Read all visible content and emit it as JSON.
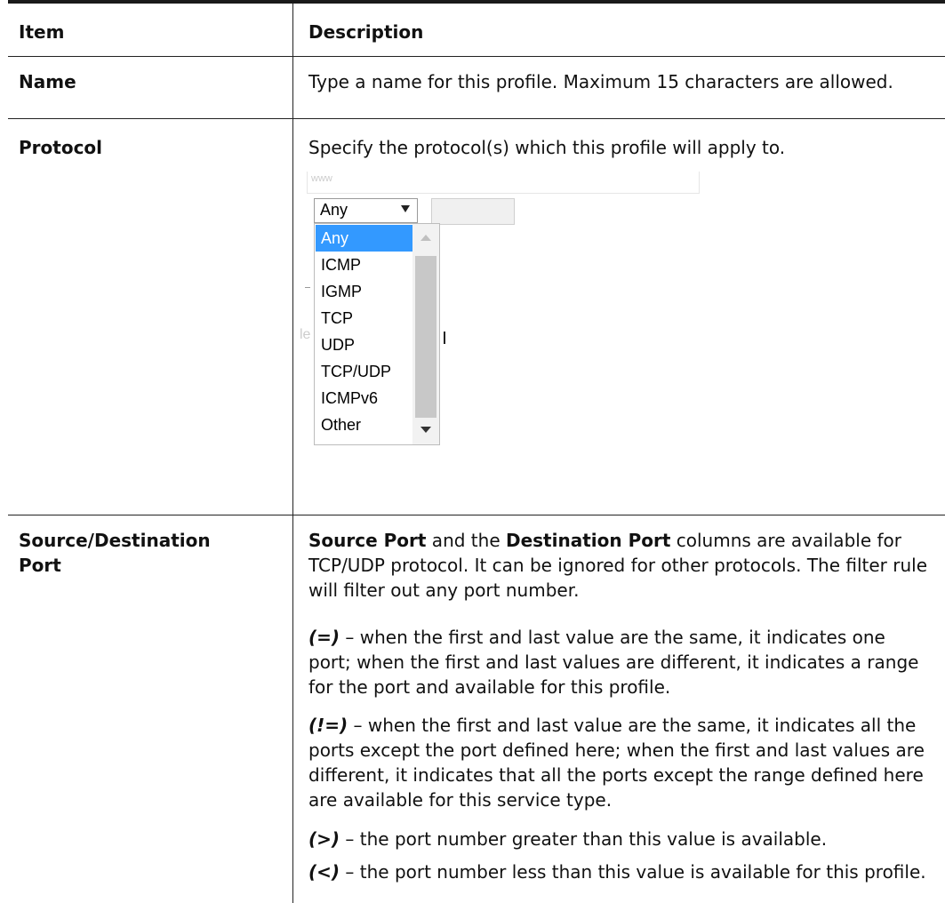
{
  "table": {
    "header": {
      "item": "Item",
      "description": "Description"
    },
    "rows": [
      {
        "item": "Name",
        "description": "Type a name for this profile. Maximum 15 characters are allowed."
      },
      {
        "item": "Protocol",
        "description": "Specify the protocol(s) which this profile will apply to.",
        "screenshot": {
          "faded_field_text": "www",
          "select_value": "Any",
          "options": [
            "Any",
            "ICMP",
            "IGMP",
            "TCP",
            "UDP",
            "TCP/UDP",
            "ICMPv6",
            "Other"
          ],
          "selected_index": 0,
          "background_fragment": "le"
        }
      },
      {
        "item_line1": "Source/Destination",
        "item_line2": "Port",
        "intro": {
          "bold1": "Source Port",
          "text1": " and the ",
          "bold2": "Destination Port",
          "text2": " columns are available for TCP/UDP protocol. It can be ignored for other protocols. The filter rule will filter out any port number."
        },
        "items": [
          {
            "symbol": "(=)",
            "text": " – when the first and last value are the same, it indicates one port; when the first and last values are different, it indicates a range for the port and available for this profile."
          },
          {
            "symbol": "(!=)",
            "text": " – when the first and last value are the same, it indicates all the ports except the port defined here; when the first and last values are different, it indicates that all the ports except the range defined here are available for this service type."
          },
          {
            "symbol": "(>)",
            "text": " – the port number greater than this value is available."
          },
          {
            "symbol": "(<)",
            "text": " – the port number less than this value is available for this profile."
          }
        ]
      }
    ]
  },
  "colors": {
    "selected_option": "#3399ff",
    "rule": "#222222"
  }
}
